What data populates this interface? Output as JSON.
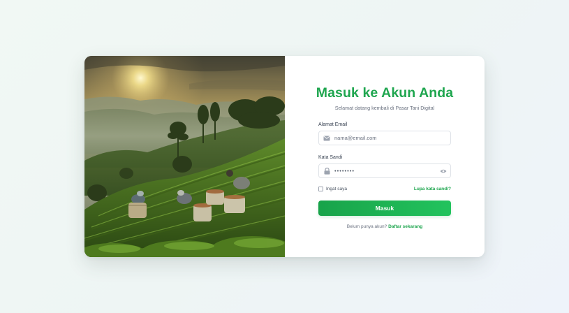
{
  "login": {
    "title": "Masuk ke Akun Anda",
    "subtitle": "Selamat datang kembali di Pasar Tani Digital",
    "email": {
      "label": "Alamat Email",
      "placeholder": "nama@email.com",
      "icon": "envelope-icon"
    },
    "password": {
      "label": "Kata Sandi",
      "value": "••••••••",
      "icon": "lock-icon",
      "toggle_icon": "eye-icon"
    },
    "remember_label": "Ingat saya",
    "forgot_label": "Lupa kata sandi?",
    "submit_label": "Masuk",
    "signup_prompt": "Belum punya akun?",
    "signup_link": "Daftar sekarang"
  },
  "colors": {
    "brand": "#1fa64f",
    "button_start": "#18a34a",
    "button_end": "#22c35d",
    "muted": "#6b7280"
  }
}
